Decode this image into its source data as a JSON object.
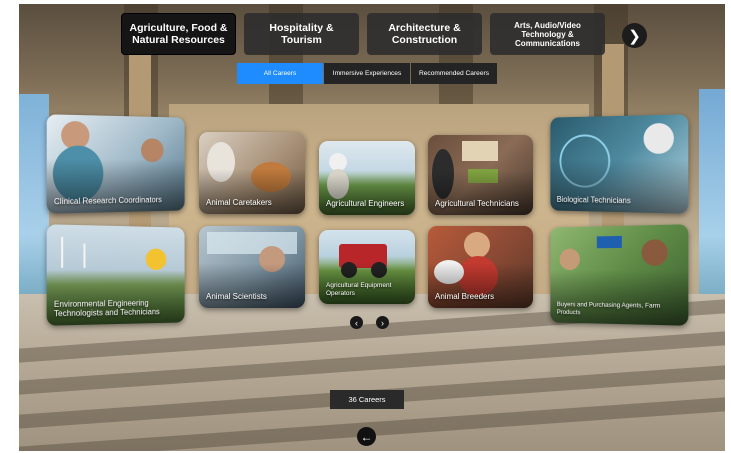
{
  "categories": [
    {
      "label": "Agriculture, Food &\nNatural Resources",
      "active": true
    },
    {
      "label": "Hospitality &\nTourism",
      "active": false
    },
    {
      "label": "Architecture &\nConstruction",
      "active": false
    },
    {
      "label": "Arts, Audio/Video\nTechnology &\nCommunications",
      "active": false
    }
  ],
  "category_next_icon": "chevron-right-icon",
  "subtabs": [
    {
      "label": "All Careers",
      "active": true
    },
    {
      "label": "Immersive Experiences",
      "active": false
    },
    {
      "label": "Recommended Careers",
      "active": false
    }
  ],
  "careers": [
    {
      "label": "Clinical Research Coordinators"
    },
    {
      "label": "Animal Caretakers"
    },
    {
      "label": "Agricultural Engineers"
    },
    {
      "label": "Agricultural Technicians"
    },
    {
      "label": "Biological Technicians"
    },
    {
      "label": "Environmental Engineering Technologists and Technicians"
    },
    {
      "label": "Animal Scientists"
    },
    {
      "label": "Agricultural Equipment Operators"
    },
    {
      "label": "Animal Breeders"
    },
    {
      "label": "Buyers and Purchasing Agents, Farm Products"
    }
  ],
  "pager": {
    "prev_icon": "chevron-left-icon",
    "next_icon": "chevron-right-icon"
  },
  "career_count": "36 Careers",
  "back_icon": "arrow-left-icon",
  "colors": {
    "accent": "#1e8cff",
    "tab_bg": "#2e2e2e",
    "active_tab_bg": "#151515"
  }
}
